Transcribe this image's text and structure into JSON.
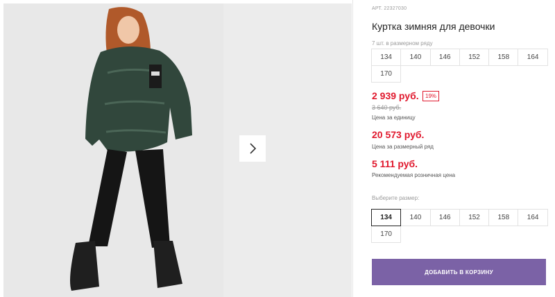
{
  "product": {
    "article": "АРТ. 22327030",
    "title": "Куртка зимняя для девочки",
    "pcs_in_row": "7 шт. в размерном ряду",
    "row_sizes": [
      "134",
      "140",
      "146",
      "152",
      "158",
      "164",
      "170"
    ]
  },
  "prices": {
    "unit_price": "2 939 руб.",
    "discount": "19%",
    "old_price": "3 640 руб.",
    "unit_note": "Цена за единицу",
    "row_price": "20 573 руб.",
    "row_note": "Цена за размерный ряд",
    "retail_price": "5 111 руб.",
    "retail_note": "Рекомендуемая розничная цена"
  },
  "size_select": {
    "label": "Выберите размер:",
    "sizes": [
      "134",
      "140",
      "146",
      "152",
      "158",
      "164",
      "170"
    ],
    "selected": "134"
  },
  "cart": {
    "add_label": "ДОБАВИТЬ В КОРЗИНУ"
  },
  "colors": {
    "price_red": "#e0182d",
    "button_purple": "#7b62a6"
  },
  "icons": {
    "next": "chevron-right-icon"
  }
}
